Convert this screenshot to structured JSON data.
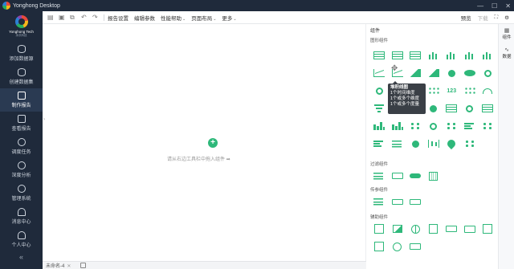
{
  "window": {
    "title": "Yonghong Desktop",
    "controls": [
      "—",
      "☐",
      "✕"
    ]
  },
  "sidebar": {
    "brand_name": "Yonghong Tech",
    "brand_sub": "永洪科技",
    "items": [
      {
        "label": "添加数据源",
        "icon": "database-icon"
      },
      {
        "label": "创建数据集",
        "icon": "dataset-icon"
      },
      {
        "label": "制作报告",
        "icon": "report-icon",
        "active": true
      },
      {
        "label": "查看报告",
        "icon": "view-report-icon"
      },
      {
        "label": "调度任务",
        "icon": "schedule-icon"
      },
      {
        "label": "深度分析",
        "icon": "analysis-icon"
      },
      {
        "label": "管理系统",
        "icon": "settings-icon"
      },
      {
        "label": "消息中心",
        "icon": "bell-icon"
      },
      {
        "label": "个人中心",
        "icon": "user-icon"
      }
    ],
    "collapse_glyph": "«"
  },
  "toolbar": {
    "menus": [
      {
        "label": "报告设置",
        "caret": false
      },
      {
        "label": "编辑参数",
        "caret": false
      },
      {
        "label": "性能帮助",
        "caret": true
      },
      {
        "label": "页面布局",
        "caret": true
      },
      {
        "label": "更多",
        "caret": true
      }
    ],
    "preview_label": "预览",
    "download_label": "下载",
    "caret_glyph": "⌄"
  },
  "canvas": {
    "add_glyph": "+",
    "hint": "请从右边工具栏中拖入组件 ➡"
  },
  "bottombar": {
    "tab_label": "未命名-4",
    "close_glyph": "✕"
  },
  "panel": {
    "title": "组件",
    "sections": {
      "charts": "图形组件",
      "filters": "过滤组件",
      "params": "传参组件",
      "assist": "辅助组件"
    },
    "tooltip": {
      "title": "堆积线图",
      "lines": [
        "1个时间维度",
        "1个或多个维度",
        "1个或多个度量"
      ]
    }
  },
  "rightrail": {
    "items": [
      {
        "label": "组件",
        "icon": "component-icon"
      },
      {
        "label": "数据",
        "icon": "data-icon"
      }
    ]
  },
  "colors": {
    "accent": "#2eb87a",
    "sidebar_bg": "#1f2a3b"
  }
}
